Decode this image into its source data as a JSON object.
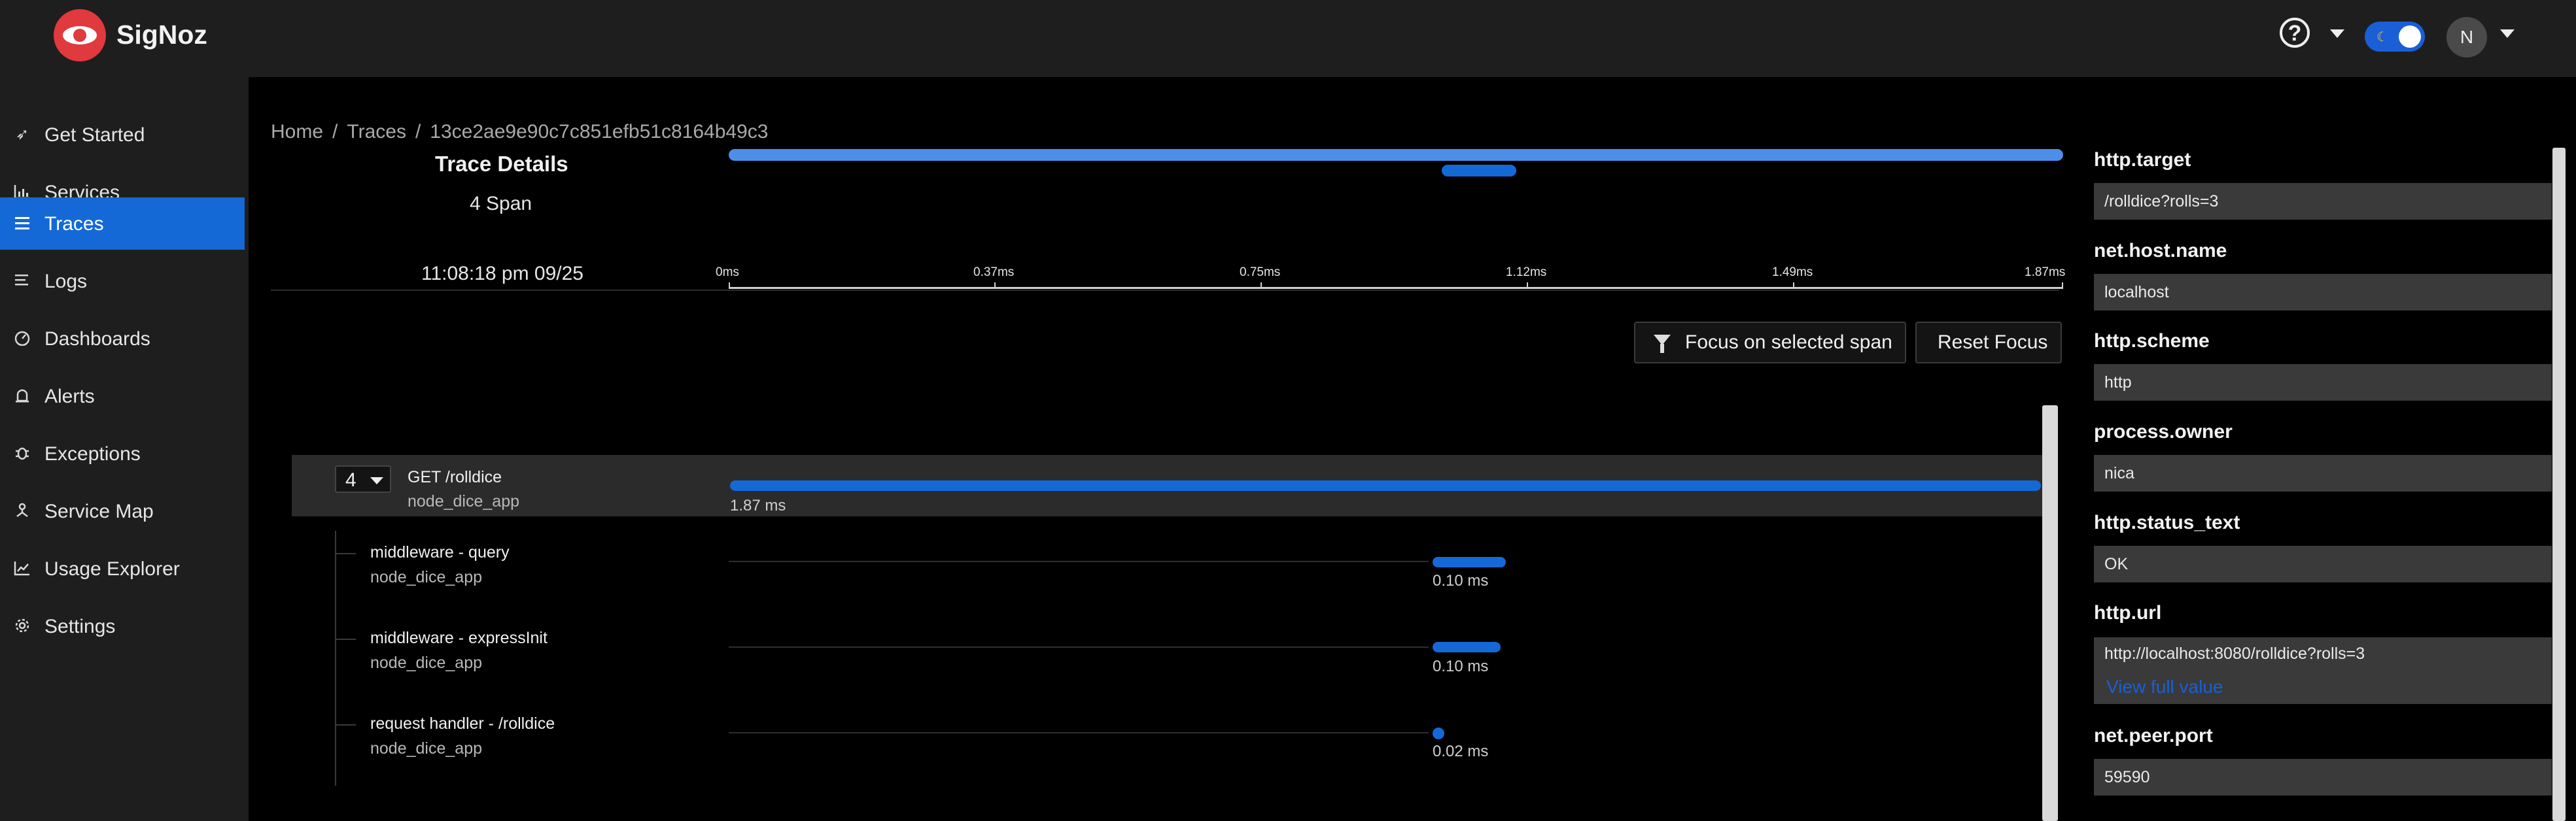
{
  "app": {
    "brand": "SigNoz"
  },
  "header": {
    "help_icon": "question-circle-icon",
    "theme_toggle": "dark-mode-toggle",
    "avatar_initial": "N"
  },
  "colors": {
    "accent": "#1469d7",
    "bar_light": "#4d8ee8",
    "logo": "#e0393e"
  },
  "sidebar": {
    "items": [
      {
        "label": "Get Started",
        "icon": "rocket-icon"
      },
      {
        "label": "Services",
        "icon": "bar-chart-icon"
      },
      {
        "label": "Traces",
        "icon": "menu-icon",
        "active": true
      },
      {
        "label": "Logs",
        "icon": "list-icon"
      },
      {
        "label": "Dashboards",
        "icon": "dashboard-icon"
      },
      {
        "label": "Alerts",
        "icon": "alarm-icon"
      },
      {
        "label": "Exceptions",
        "icon": "bug-icon"
      },
      {
        "label": "Service Map",
        "icon": "deployment-icon"
      },
      {
        "label": "Usage Explorer",
        "icon": "line-chart-icon"
      },
      {
        "label": "Settings",
        "icon": "gear-icon"
      }
    ]
  },
  "breadcrumb": {
    "home": "Home",
    "traces": "Traces",
    "trace_id": "13ce2ae9e90c7c851efb51c8164b49c3"
  },
  "trace": {
    "title": "Trace Details",
    "span_count": "4 Span",
    "start_time": "11:08:18 pm 09/25",
    "ticks": [
      "0ms",
      "0.37ms",
      "0.75ms",
      "1.12ms",
      "1.49ms",
      "1.87ms"
    ]
  },
  "actions": {
    "focus": "Focus on selected span",
    "reset": "Reset Focus"
  },
  "spans": {
    "root": {
      "count": "4",
      "name": "GET /rolldice",
      "service": "node_dice_app",
      "duration": "1.87 ms"
    },
    "children": [
      {
        "name": "middleware - query",
        "service": "node_dice_app",
        "duration": "0.10 ms"
      },
      {
        "name": "middleware - expressInit",
        "service": "node_dice_app",
        "duration": "0.10 ms"
      },
      {
        "name": "request handler - /rolldice",
        "service": "node_dice_app",
        "duration": "0.02 ms"
      }
    ]
  },
  "attributes": [
    {
      "key": "http.target",
      "value": "/rolldice?rolls=3"
    },
    {
      "key": "net.host.name",
      "value": "localhost"
    },
    {
      "key": "http.scheme",
      "value": "http"
    },
    {
      "key": "process.owner",
      "value": "nica"
    },
    {
      "key": "http.status_text",
      "value": "OK"
    },
    {
      "key": "http.url",
      "value": "http://localhost:8080/rolldice?rolls=3",
      "link": "View full value"
    },
    {
      "key": "net.peer.port",
      "value": "59590"
    }
  ]
}
